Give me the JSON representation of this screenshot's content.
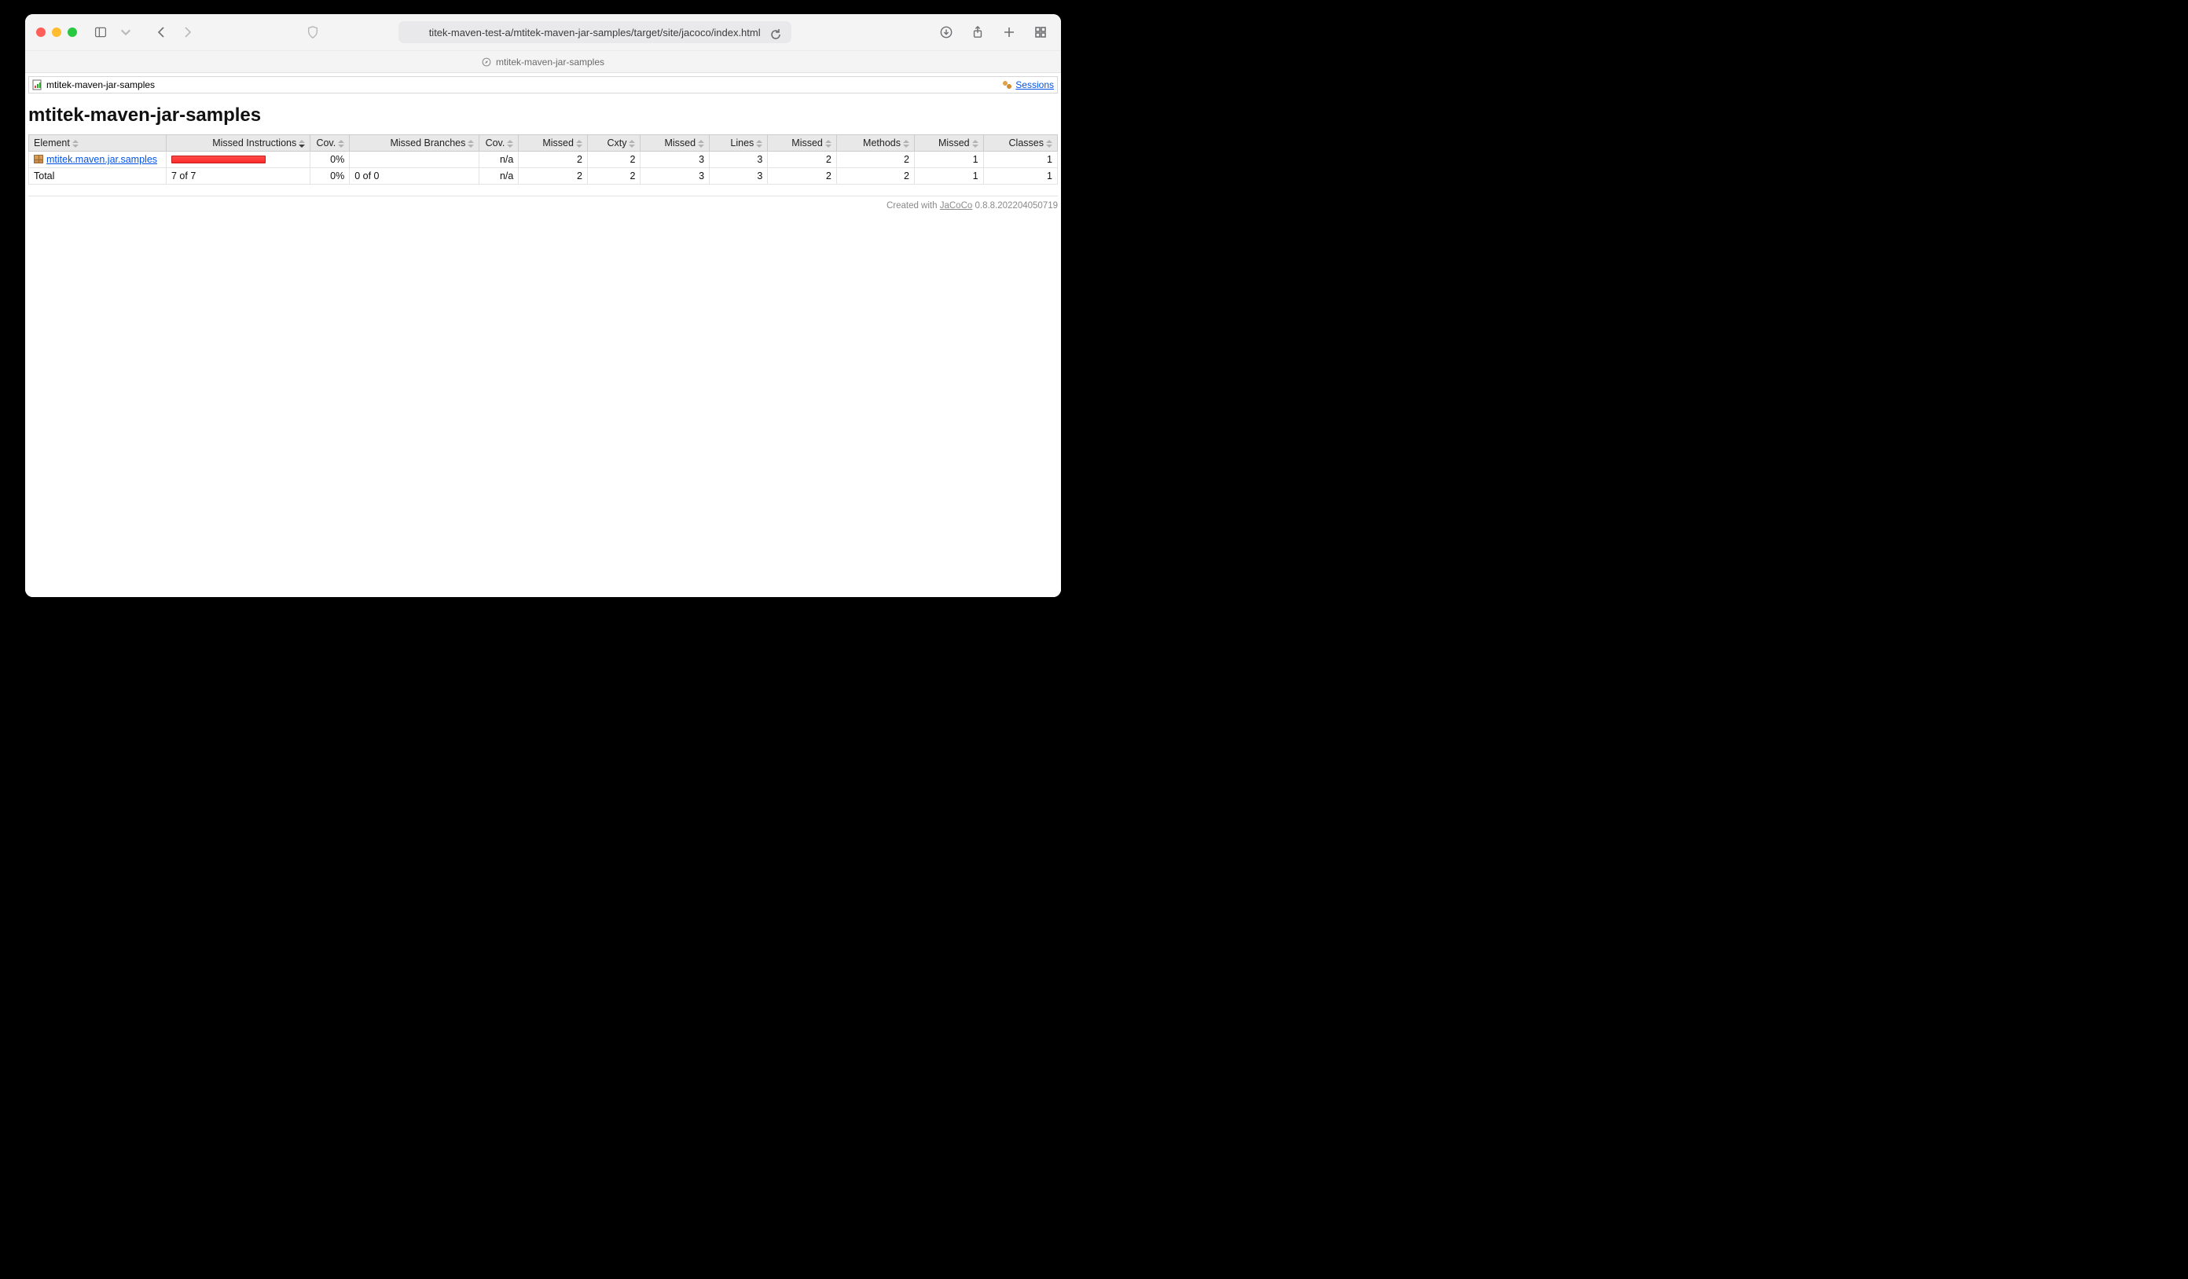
{
  "browser": {
    "url": "titek-maven-test-a/mtitek-maven-jar-samples/target/site/jacoco/index.html",
    "tab_title": "mtitek-maven-jar-samples"
  },
  "breadcrumb": {
    "project": "mtitek-maven-jar-samples",
    "sessions_label": "Sessions"
  },
  "page_title": "mtitek-maven-jar-samples",
  "table": {
    "headers": {
      "element": "Element",
      "missed_instr": "Missed Instructions",
      "cov1": "Cov.",
      "missed_branches": "Missed Branches",
      "cov2": "Cov.",
      "missed1": "Missed",
      "cxty": "Cxty",
      "missed2": "Missed",
      "lines": "Lines",
      "missed3": "Missed",
      "methods": "Methods",
      "missed4": "Missed",
      "classes": "Classes"
    },
    "row": {
      "element": "mtitek.maven.jar.samples",
      "cov1": "0%",
      "missed_branches": "",
      "cov2": "n/a",
      "missed1": "2",
      "cxty": "2",
      "missed2": "3",
      "lines": "3",
      "missed3": "2",
      "methods": "2",
      "missed4": "1",
      "classes": "1"
    },
    "total": {
      "label": "Total",
      "missed_instr": "7 of 7",
      "cov1": "0%",
      "missed_branches": "0 of 0",
      "cov2": "n/a",
      "missed1": "2",
      "cxty": "2",
      "missed2": "3",
      "lines": "3",
      "missed3": "2",
      "methods": "2",
      "missed4": "1",
      "classes": "1"
    }
  },
  "footer": {
    "prefix": "Created with ",
    "tool": "JaCoCo",
    "version": " 0.8.8.202204050719"
  }
}
